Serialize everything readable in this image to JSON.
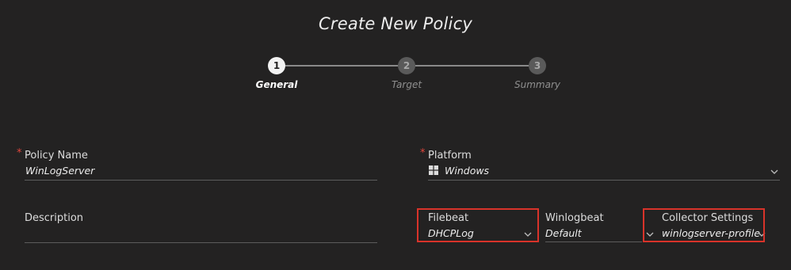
{
  "page": {
    "title": "Create New Policy"
  },
  "stepper": {
    "steps": [
      {
        "number": "1",
        "label": "General",
        "state": "active"
      },
      {
        "number": "2",
        "label": "Target",
        "state": "inactive"
      },
      {
        "number": "3",
        "label": "Summary",
        "state": "inactive"
      }
    ]
  },
  "form": {
    "policy_name": {
      "label": "Policy Name",
      "value": "WinLogServer",
      "required": true
    },
    "platform": {
      "label": "Platform",
      "value": "Windows",
      "icon": "windows-icon",
      "required": true
    },
    "description": {
      "label": "Description",
      "value": ""
    },
    "filebeat": {
      "label": "Filebeat",
      "value": "DHCPLog"
    },
    "winlogbeat": {
      "label": "Winlogbeat",
      "value": "Default"
    },
    "collector_settings": {
      "label": "Collector Settings",
      "value": "winlogserver-profile"
    }
  },
  "colors": {
    "background": "#232222",
    "required_marker": "#e0463c",
    "highlight_box": "#d8332a",
    "active_step": "#f2f2f2",
    "inactive_step": "#5a5a5a"
  }
}
